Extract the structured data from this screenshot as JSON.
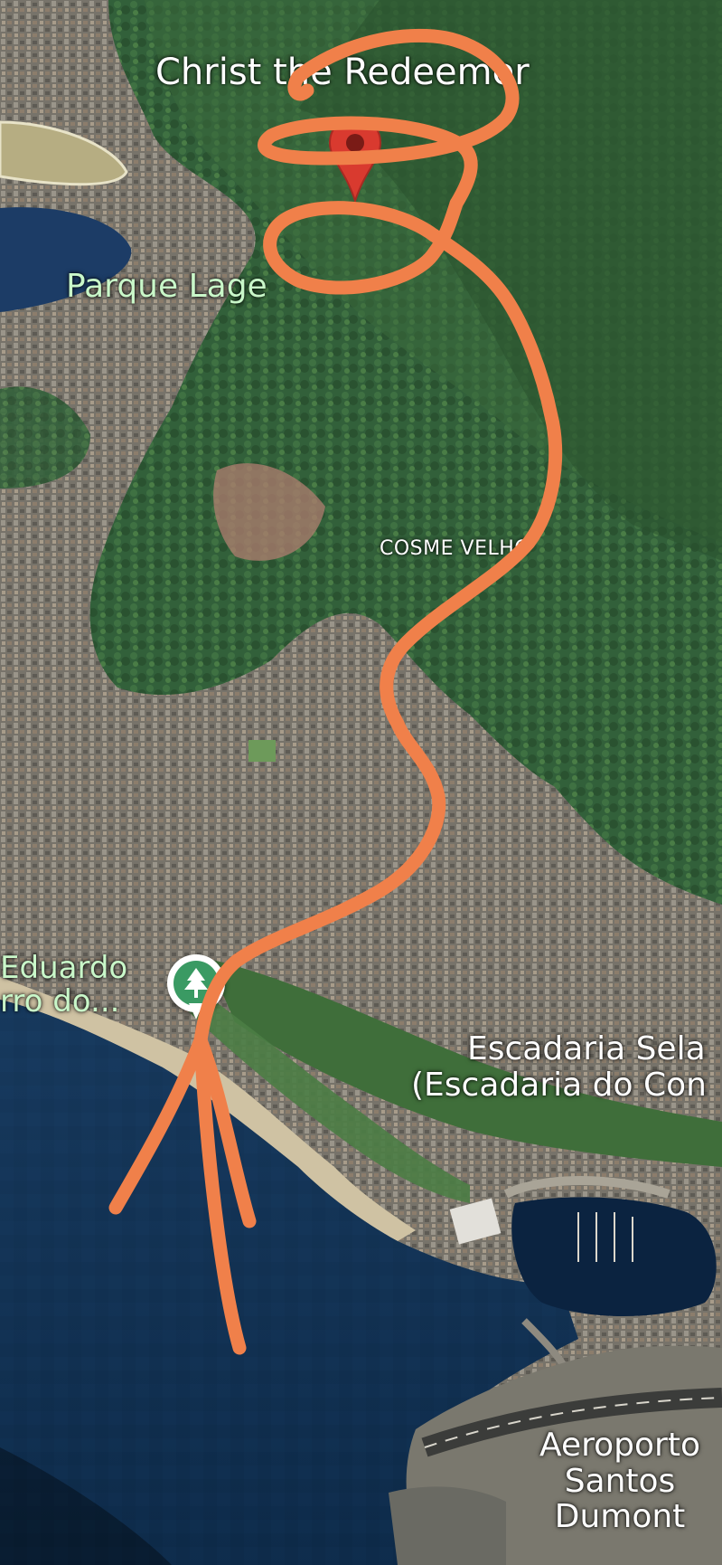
{
  "map": {
    "view": "3D satellite",
    "colors": {
      "water": "#0c2a48",
      "forest": "#2f5a2e",
      "urban": "#6b6a62",
      "annotation": "#f0804a",
      "pin_red": "#d93a2f",
      "park_green": "#3a9a63"
    }
  },
  "labels": {
    "christ": "Christ the Redeemer",
    "parque_lage": "Parque Lage",
    "cosme_velho": "COSME VELHO",
    "eduardo_line1": "Eduardo",
    "eduardo_line2": "rro do...",
    "escadaria_line1": "Escadaria Sela",
    "escadaria_line2": "(Escadaria do Con",
    "aeroporto_line1": "Aeroporto",
    "aeroporto_line2": "Santos",
    "aeroporto_line3": "Dumont"
  },
  "markers": {
    "destination": "map-pin-icon",
    "park": "tree-icon"
  },
  "annotation": {
    "type": "hand-drawn route",
    "color": "#f0804a"
  }
}
